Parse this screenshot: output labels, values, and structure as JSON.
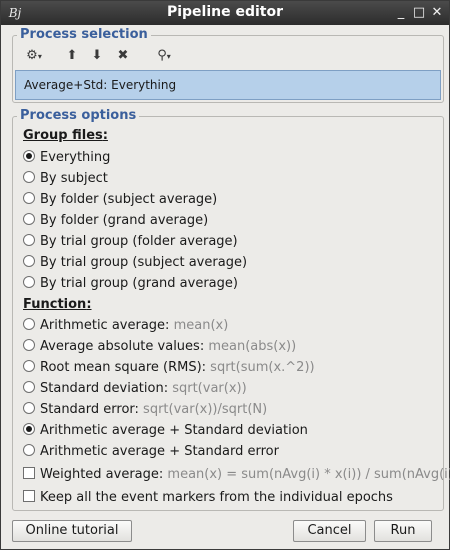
{
  "window": {
    "title": "Pipeline editor",
    "app_icon": "Bj"
  },
  "process_selection": {
    "title": "Process selection",
    "toolbar": [
      "gear-dropdown",
      "move-up",
      "move-down",
      "delete",
      "pipeline-tree-dropdown"
    ],
    "items": [
      "Average+Std: Everything"
    ]
  },
  "process_options": {
    "title": "Process options",
    "group_files": {
      "label": "Group files",
      "selected": "Everything",
      "options": [
        "Everything",
        "By subject",
        "By folder (subject average)",
        "By folder (grand average)",
        "By trial group (folder average)",
        "By trial group (subject average)",
        "By trial group (grand average)"
      ]
    },
    "function": {
      "label": "Function",
      "selected": "Arithmetic average + Standard deviation",
      "options": [
        {
          "label": "Arithmetic average:",
          "hint": "mean(x)"
        },
        {
          "label": "Average absolute values:",
          "hint": "mean(abs(x))"
        },
        {
          "label": "Root mean square (RMS):",
          "hint": "sqrt(sum(x.^2))"
        },
        {
          "label": "Standard deviation:",
          "hint": "sqrt(var(x))"
        },
        {
          "label": "Standard error:",
          "hint": "sqrt(var(x))/sqrt(N)"
        },
        {
          "label": "Arithmetic average + Standard deviation",
          "hint": ""
        },
        {
          "label": "Arithmetic average + Standard error",
          "hint": ""
        }
      ]
    },
    "weighted": {
      "label": "Weighted average:",
      "hint": "mean(x) = sum(nAvg(i) * x(i)) / sum(nAvg(i))",
      "checked": false
    },
    "keep_markers": {
      "label": "Keep all the event markers from the individual epochs",
      "checked": false
    }
  },
  "buttons": {
    "tutorial": "Online tutorial",
    "cancel": "Cancel",
    "run": "Run"
  }
}
